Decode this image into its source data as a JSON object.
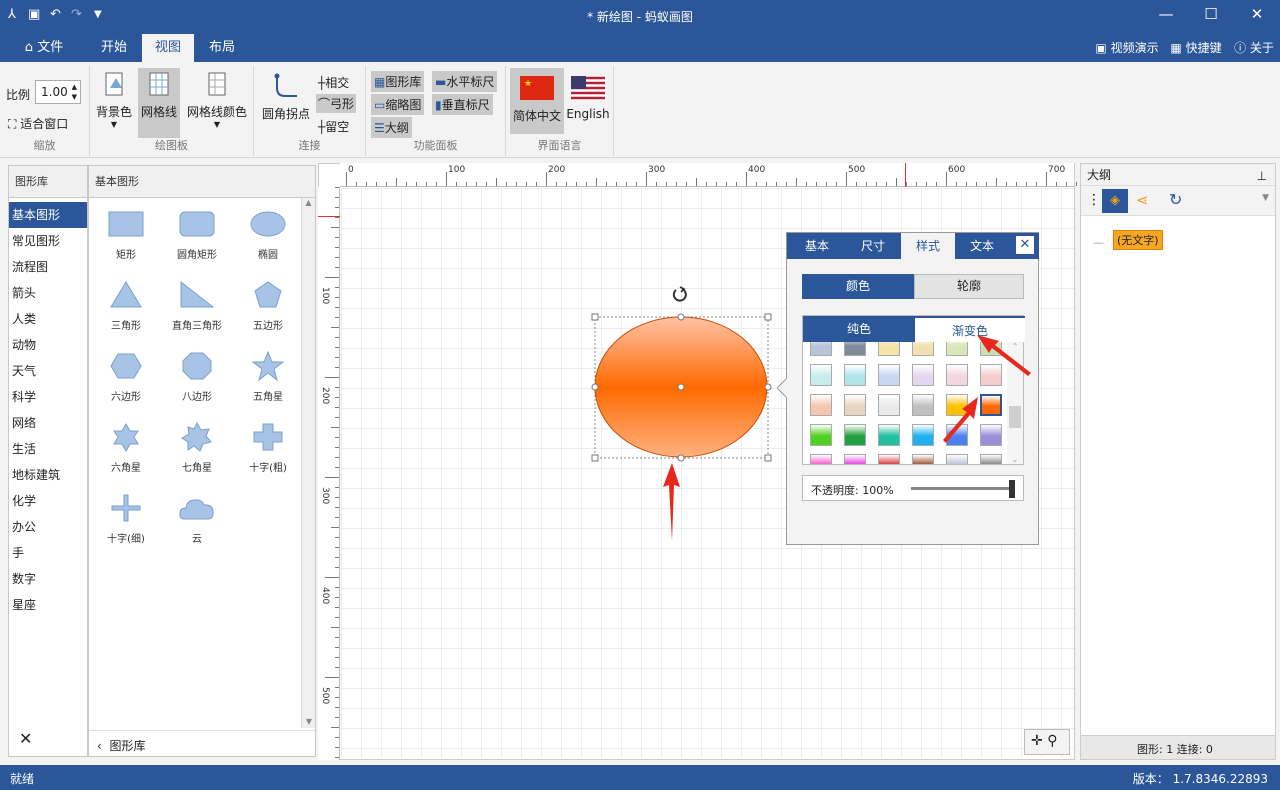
{
  "window": {
    "title": "* 新绘图 - 蚂蚁画图"
  },
  "menu_tabs": [
    "文件",
    "开始",
    "视图",
    "布局"
  ],
  "right_links": {
    "video": "视频演示",
    "shortcut": "快捷键",
    "about": "关于"
  },
  "ribbon": {
    "zoom": {
      "scale_label": "比例",
      "scale_value": "1.00",
      "fit_label": "适合窗口",
      "group": "缩放"
    },
    "canvas": {
      "bg_color": "背景色",
      "grid": "网格线",
      "grid_color": "网格线颜色",
      "group": "绘图板"
    },
    "connect": {
      "round_corner": "圆角拐点",
      "intersect": "相交",
      "arc": "弓形",
      "gap": "留空",
      "group": "连接"
    },
    "panels": {
      "library": "图形库",
      "thumb": "缩略图",
      "outline": "大纲",
      "hruler": "水平标尺",
      "vruler": "垂直标尺",
      "group": "功能面板"
    },
    "lang": {
      "zh": "简体中文",
      "en": "English",
      "group": "界面语言"
    }
  },
  "library": {
    "header": "图形库",
    "categories": [
      "基本图形",
      "常见图形",
      "流程图",
      "箭头",
      "人类",
      "动物",
      "天气",
      "科学",
      "网络",
      "生活",
      "地标建筑",
      "化学",
      "办公",
      "手",
      "数字",
      "星座"
    ],
    "selected": "基本图形",
    "footer": "图形库"
  },
  "shapes": {
    "header": "基本图形",
    "items": [
      "矩形",
      "圆角矩形",
      "椭圆",
      "三角形",
      "直角三角形",
      "五边形",
      "六边形",
      "八边形",
      "五角星",
      "六角星",
      "七角星",
      "十字(粗)",
      "十字(细)",
      "云"
    ]
  },
  "ruler": {
    "h": [
      "0",
      "100",
      "200",
      "300",
      "400",
      "500",
      "600",
      "700"
    ],
    "v": [
      "100",
      "200",
      "300",
      "400",
      "500"
    ]
  },
  "popup": {
    "tabs": [
      "基本",
      "尺寸",
      "样式",
      "文本"
    ],
    "active_tab": "样式",
    "subtabs": [
      "颜色",
      "轮廓"
    ],
    "fill_tabs": [
      "纯色",
      "渐变色"
    ],
    "opacity_label": "不透明度: 100%",
    "opacity": 1.0
  },
  "outline": {
    "title": "大纲",
    "node": "(无文字)",
    "footer": "图形: 1  连接: 0"
  },
  "status": {
    "left": "就绪",
    "version": "版本： 1.7.8346.22893"
  },
  "colors": {
    "accent": "#2b579a",
    "ellipse": "#ff6a00"
  }
}
